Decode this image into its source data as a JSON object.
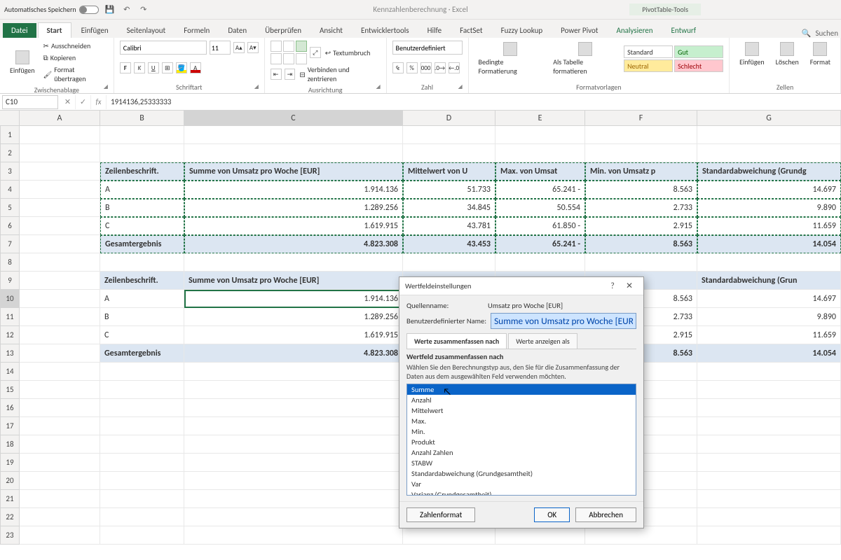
{
  "titlebar": {
    "autosave": "Automatisches Speichern",
    "doc_title": "Kennzahlenberechnung  ·  Excel",
    "pivot_tools": "PivotTable-Tools"
  },
  "tabs": {
    "file": "Datei",
    "start": "Start",
    "einfuegen": "Einfügen",
    "seitenlayout": "Seitenlayout",
    "formeln": "Formeln",
    "daten": "Daten",
    "ueberpruefen": "Überprüfen",
    "ansicht": "Ansicht",
    "entwickler": "Entwicklertools",
    "hilfe": "Hilfe",
    "factset": "FactSet",
    "fuzzy": "Fuzzy Lookup",
    "powerpivot": "Power Pivot",
    "analysieren": "Analysieren",
    "entwurf": "Entwurf",
    "suchen": "Suchen"
  },
  "ribbon": {
    "clipboard": {
      "paste": "Einfügen",
      "cut": "Ausschneiden",
      "copy": "Kopieren",
      "format_painter": "Format übertragen",
      "label": "Zwischenablage"
    },
    "font": {
      "name": "Calibri",
      "size": "11",
      "label": "Schriftart"
    },
    "align": {
      "wrap": "Textumbruch",
      "merge": "Verbinden und zentrieren",
      "label": "Ausrichtung"
    },
    "number": {
      "format": "Benutzerdefiniert",
      "label": "Zahl"
    },
    "cond": {
      "cond_fmt": "Bedingte Formatierung",
      "as_table": "Als Tabelle formatieren"
    },
    "styles": {
      "standard": "Standard",
      "gut": "Gut",
      "neutral": "Neutral",
      "schlecht": "Schlecht",
      "label": "Formatvorlagen"
    },
    "cells": {
      "insert": "Einfügen",
      "delete": "Löschen",
      "format": "Format",
      "label": "Zellen"
    }
  },
  "formula_bar": {
    "namebox": "C10",
    "formula": "1914136,25333333"
  },
  "columns": [
    "A",
    "B",
    "C",
    "D",
    "E",
    "F",
    "G"
  ],
  "pivot1": {
    "headers": [
      "Zeilenbeschrift.",
      "Summe von Umsatz pro Woche [EUR]",
      "Mittelwert von U",
      "Max. von Umsat",
      "Min. von Umsatz p",
      "Standardabweichung (Grundg"
    ],
    "rows": [
      {
        "lbl": "A",
        "c": "1.914.136",
        "d": "51.733",
        "e": "65.241",
        "f": "8.563",
        "g": "14.697",
        "e_prefix": "-"
      },
      {
        "lbl": "B",
        "c": "1.289.256",
        "d": "34.845",
        "e": "50.554",
        "f": "2.733",
        "g": "9.890",
        "e_prefix": ""
      },
      {
        "lbl": "C",
        "c": "1.619.915",
        "d": "43.781",
        "e": "61.850",
        "f": "2.915",
        "g": "11.659",
        "e_prefix": "-"
      }
    ],
    "total": {
      "lbl": "Gesamtergebnis",
      "c": "4.823.308",
      "d": "43.453",
      "e": "65.241",
      "f": "8.563",
      "g": "14.054",
      "e_prefix": "-"
    }
  },
  "pivot2": {
    "headers": [
      "Zeilenbeschrift.",
      "Summe von Umsatz pro Woche [EUR]",
      "",
      "",
      "",
      "Standardabweichung (Grun"
    ],
    "rows": [
      {
        "lbl": "A",
        "c": "1.914.136",
        "f": "8.563",
        "g": "14.697"
      },
      {
        "lbl": "B",
        "c": "1.289.256",
        "f": "2.733",
        "g": "9.890"
      },
      {
        "lbl": "C",
        "c": "1.619.915",
        "f": "2.915",
        "g": "11.659"
      }
    ],
    "total": {
      "lbl": "Gesamtergebnis",
      "c": "4.823.308",
      "f": "8.563",
      "g": "14.054"
    }
  },
  "dialog": {
    "title": "Wertfeldeinstellungen",
    "source_lbl": "Quellenname:",
    "source_val": "Umsatz pro Woche [EUR]",
    "custom_lbl": "Benutzerdefinierter Name:",
    "custom_val": "Summe von Umsatz pro Woche [EUR]",
    "tab1": "Werte zusammenfassen nach",
    "tab2": "Werte anzeigen als",
    "section": "Wertfeld zusammenfassen nach",
    "desc": "Wählen Sie den Berechnungstyp aus, den Sie für die Zusammenfassung der Daten aus dem ausgewählten Feld verwenden möchten.",
    "options": [
      "Summe",
      "Anzahl",
      "Mittelwert",
      "Max.",
      "Min.",
      "Produkt",
      "Anzahl Zahlen",
      "STABW",
      "Standardabweichung (Grundgesamtheit)",
      "Var",
      "Varianz (Grundgesamtheit)"
    ],
    "num_format": "Zahlenformat",
    "ok": "OK",
    "cancel": "Abbrechen"
  }
}
